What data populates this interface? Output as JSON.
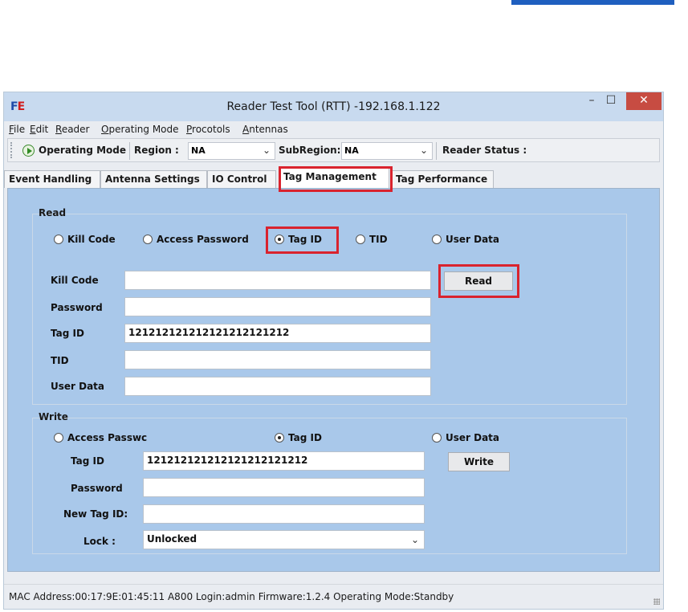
{
  "window": {
    "title": "Reader Test Tool (RTT) -192.168.1.122",
    "logo": {
      "left": "F",
      "right": "E"
    },
    "controls": {
      "minimize": "–",
      "maximize": "☐",
      "close": "✕"
    }
  },
  "menu": [
    {
      "label": "File",
      "underline": "F",
      "rest": "ile"
    },
    {
      "label": "Edit",
      "underline": "E",
      "rest": "dit"
    },
    {
      "label": "Reader",
      "underline": "R",
      "rest": "eader"
    },
    {
      "label": "Operating Mode",
      "underline": "O",
      "rest": "perating Mode"
    },
    {
      "label": "Procotols",
      "underline": "P",
      "rest": "rocotols"
    },
    {
      "label": "Antennas",
      "underline": "A",
      "rest": "ntennas"
    }
  ],
  "toolbar": {
    "operating_mode_label": "Operating Mode",
    "region_label": "Region :",
    "region_value": "NA",
    "subregion_label": "SubRegion:",
    "subregion_value": "NA",
    "reader_status_label": "Reader Status :",
    "chevron": "⌄"
  },
  "tabs": [
    {
      "label": "Event Handling",
      "active": false
    },
    {
      "label": "Antenna Settings",
      "active": false
    },
    {
      "label": "IO Control",
      "active": false
    },
    {
      "label": "Tag Management",
      "active": true
    },
    {
      "label": "Tag Performance",
      "active": false
    }
  ],
  "read": {
    "title": "Read",
    "radios": [
      {
        "label": "Kill Code",
        "selected": false
      },
      {
        "label": "Access Password",
        "selected": false
      },
      {
        "label": "Tag ID",
        "selected": true
      },
      {
        "label": "TID",
        "selected": false
      },
      {
        "label": "User Data",
        "selected": false
      }
    ],
    "fields": [
      {
        "label": "Kill Code",
        "value": ""
      },
      {
        "label": "Password",
        "value": ""
      },
      {
        "label": "Tag ID",
        "value": "121212121212121212121212"
      },
      {
        "label": "TID",
        "value": ""
      },
      {
        "label": "User Data",
        "value": ""
      }
    ],
    "button": "Read"
  },
  "write": {
    "title": "Write",
    "radios": [
      {
        "label": "Access Passwc",
        "selected": false
      },
      {
        "label": "Tag ID",
        "selected": true
      },
      {
        "label": "User Data",
        "selected": false
      }
    ],
    "fields": [
      {
        "label": "Tag ID",
        "value": "121212121212121212121212"
      },
      {
        "label": "Password",
        "value": ""
      },
      {
        "label": "New Tag ID:",
        "value": ""
      }
    ],
    "lock_label": "Lock :",
    "lock_value": "Unlocked",
    "button": "Write"
  },
  "status": {
    "text": "MAC Address:00:17:9E:01:45:11   A800  Login:admin  Firmware:1.2.4   Operating Mode:Standby"
  },
  "colors": {
    "panel": "#a9c8ea",
    "highlight": "#d9232e",
    "titlebar": "#c8daef",
    "close": "#c74c42"
  }
}
